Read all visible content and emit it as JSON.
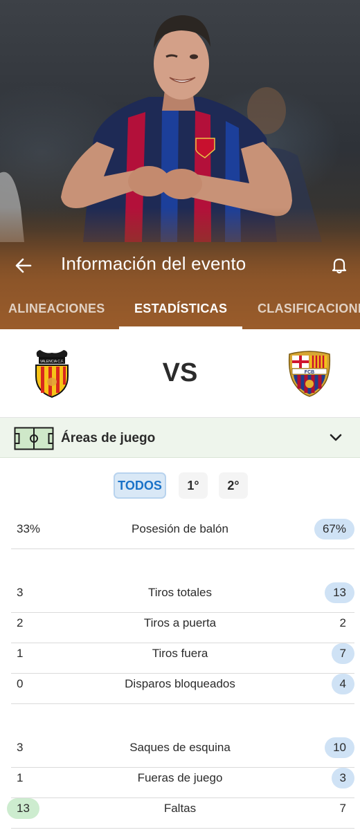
{
  "header": {
    "title": "Información del evento"
  },
  "tabs": [
    {
      "label": "ALINEACIONES"
    },
    {
      "label": "ESTADÍSTICAS"
    },
    {
      "label": "CLASIFICACIONES"
    }
  ],
  "active_tab": 1,
  "match": {
    "vs_label": "VS",
    "home_crest_icon": "valencia-crest-icon",
    "away_crest_icon": "barcelona-crest-icon",
    "home_crest_text": "VALENCIA C.F.",
    "away_crest_text": "FCB"
  },
  "areas": {
    "label": "Áreas de juego"
  },
  "filters": [
    {
      "label": "TODOS",
      "selected": true
    },
    {
      "label": "1°",
      "selected": false
    },
    {
      "label": "2°",
      "selected": false
    }
  ],
  "stats": [
    {
      "label": "Posesión de balón",
      "home": "33%",
      "away": "67%",
      "highlight": "away"
    },
    {
      "label": "Tiros totales",
      "home": "3",
      "away": "13",
      "highlight": "away"
    },
    {
      "label": "Tiros a puerta",
      "home": "2",
      "away": "2",
      "highlight": "none"
    },
    {
      "label": "Tiros fuera",
      "home": "1",
      "away": "7",
      "highlight": "away"
    },
    {
      "label": "Disparos bloqueados",
      "home": "0",
      "away": "4",
      "highlight": "away"
    },
    {
      "label": "Saques de esquina",
      "home": "3",
      "away": "10",
      "highlight": "away"
    },
    {
      "label": "Fueras de juego",
      "home": "1",
      "away": "3",
      "highlight": "away"
    },
    {
      "label": "Faltas",
      "home": "13",
      "away": "7",
      "highlight": "home"
    }
  ],
  "colors": {
    "home_highlight": "#cdeccf",
    "away_highlight": "#cfe2f5",
    "accent": "#1a72c8"
  }
}
